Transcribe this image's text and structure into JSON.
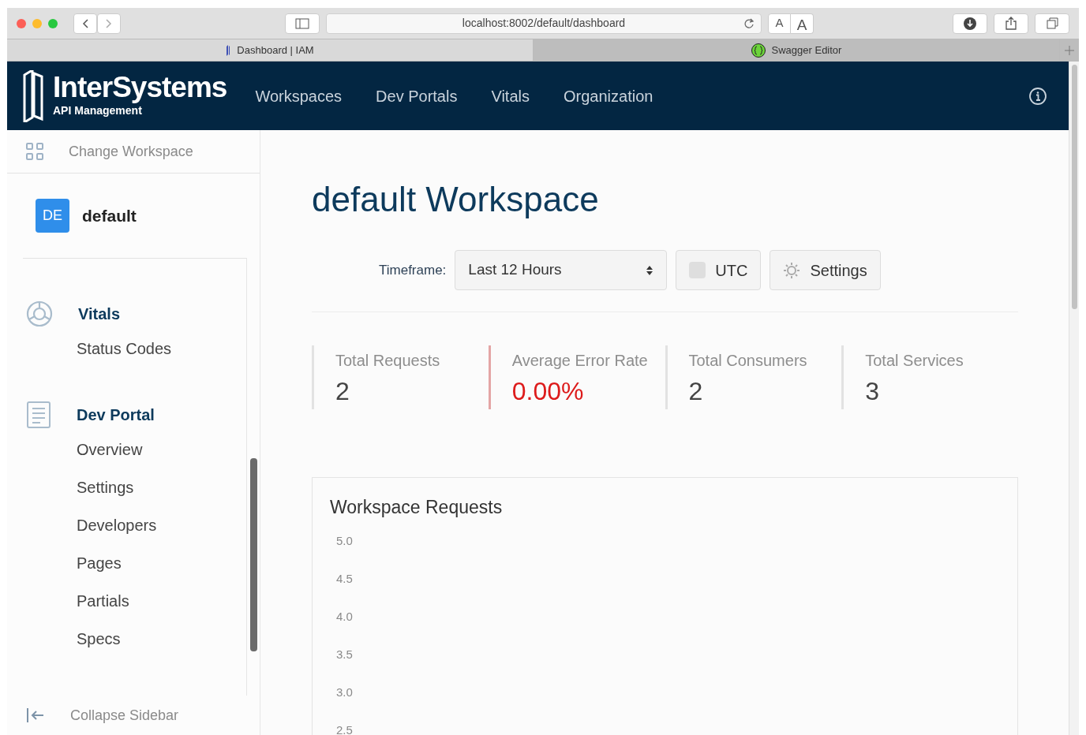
{
  "browser": {
    "url": "localhost:8002/default/dashboard",
    "text_size": [
      "A",
      "A"
    ],
    "tabs": [
      {
        "title": "Dashboard | IAM",
        "selected": true
      },
      {
        "title": "Swagger Editor",
        "selected": false
      }
    ]
  },
  "header": {
    "brand": "InterSystems",
    "brand_sub": "API Management",
    "nav": [
      "Workspaces",
      "Dev Portals",
      "Vitals",
      "Organization"
    ]
  },
  "sidebar": {
    "change_workspace": "Change Workspace",
    "workspace": {
      "badge": "DE",
      "name": "default"
    },
    "sections": [
      {
        "title": "Vitals",
        "items": [
          "Status Codes"
        ]
      },
      {
        "title": "Dev Portal",
        "items": [
          "Overview",
          "Settings",
          "Developers",
          "Pages",
          "Partials",
          "Specs"
        ]
      }
    ],
    "collapse": "Collapse Sidebar"
  },
  "main": {
    "title": "default Workspace",
    "timeframe_label": "Timeframe:",
    "timeframe": "Last 12 Hours",
    "utc": {
      "label": "UTC",
      "checked": false
    },
    "settings": "Settings",
    "stats": [
      {
        "label": "Total Requests",
        "value": "2",
        "alert": false
      },
      {
        "label": "Average Error Rate",
        "value": "0.00%",
        "alert": true
      },
      {
        "label": "Total Consumers",
        "value": "2",
        "alert": false
      },
      {
        "label": "Total Services",
        "value": "3",
        "alert": false
      }
    ],
    "chart": {
      "title": "Workspace Requests",
      "y_ticks": [
        "5.0",
        "4.5",
        "4.0",
        "3.5",
        "3.0",
        "2.5"
      ]
    }
  }
}
